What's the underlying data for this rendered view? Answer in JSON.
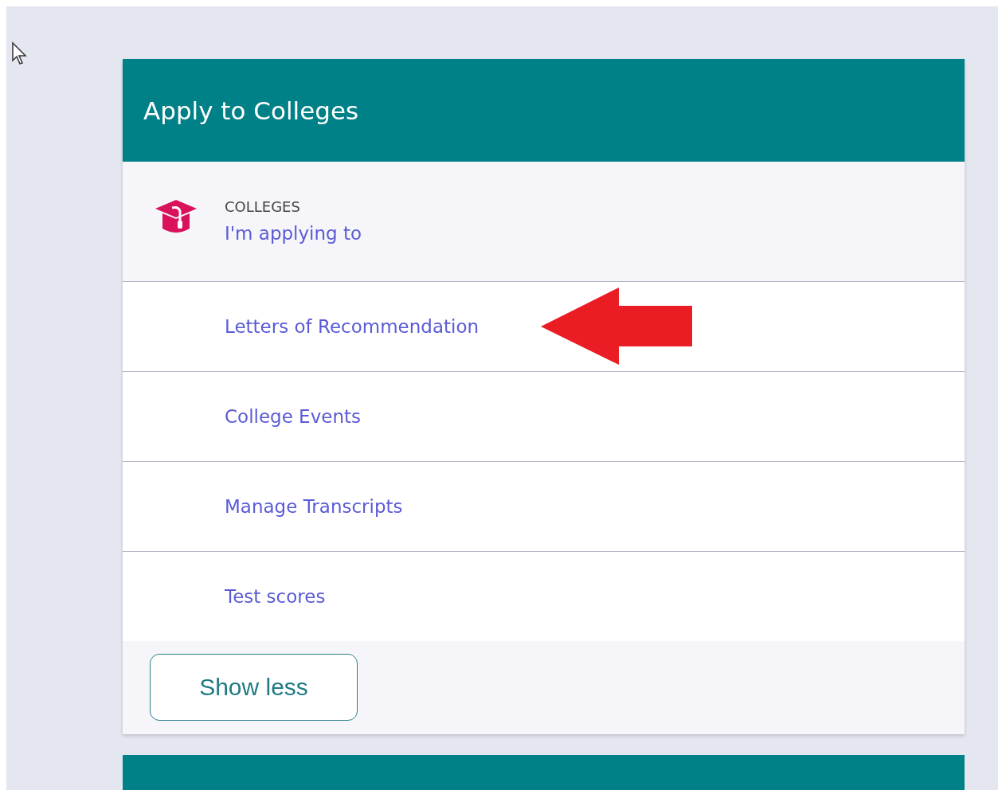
{
  "card": {
    "title": "Apply to Colleges",
    "items": [
      {
        "kind": "section",
        "label": "COLLEGES",
        "link": "I'm applying to"
      },
      {
        "kind": "link",
        "link": "Letters of Recommendation"
      },
      {
        "kind": "link",
        "link": "College Events"
      },
      {
        "kind": "link",
        "link": "Manage Transcripts"
      },
      {
        "kind": "link",
        "link": "Test scores"
      }
    ],
    "button": "Show less"
  }
}
